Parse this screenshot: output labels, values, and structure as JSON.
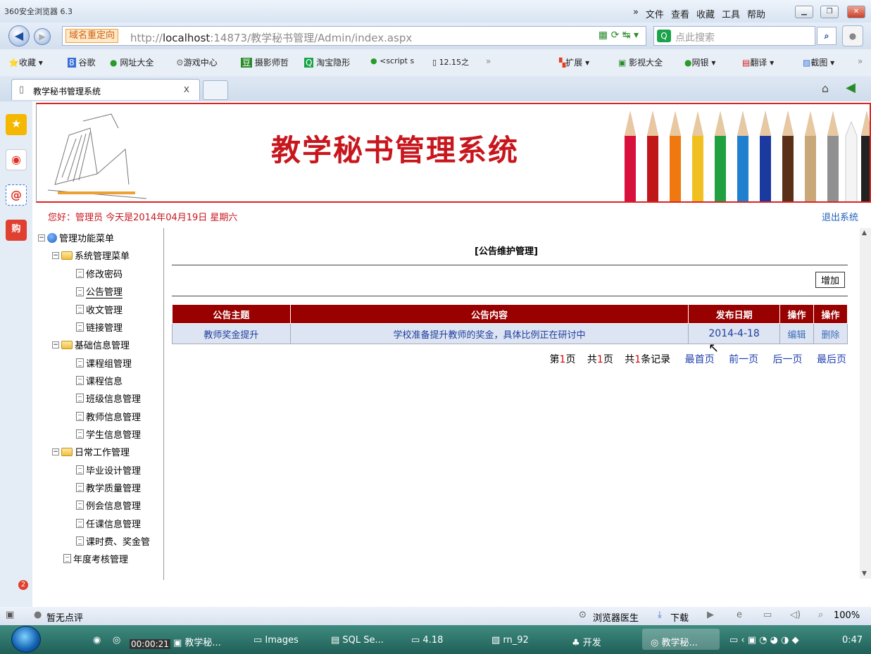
{
  "browser": {
    "app_title": "360安全浏览器 6.3",
    "menu": [
      "»",
      "文件",
      "查看",
      "收藏",
      "工具",
      "帮助"
    ],
    "redirect_badge": "域名重定向",
    "url_prefix": "http://",
    "url_host": "localhost",
    "url_rest": ":14873/教学秘书管理/Admin/index.aspx",
    "search_placeholder": "点此搜索",
    "favorites": [
      "收藏",
      "谷歌",
      "网址大全",
      "游戏中心",
      "摄影师哲",
      "淘宝隐形",
      "<script s",
      "12.15之",
      "»"
    ],
    "right_tools": [
      "扩展",
      "影视大全",
      "网银",
      "翻译",
      "截图",
      "»"
    ],
    "tab_label": "教学秘书管理系统",
    "tab_close": "x"
  },
  "site": {
    "banner_title": "教学秘书管理系统",
    "greeting": "您好：管理员   今天是2014年04月19日   星期六",
    "logout": "退出系统"
  },
  "tree": {
    "root": "管理功能菜单",
    "groups": [
      {
        "label": "系统管理菜单",
        "items": [
          "修改密码",
          "公告管理",
          "收文管理",
          "链接管理"
        ]
      },
      {
        "label": "基础信息管理",
        "items": [
          "课程组管理",
          "课程信息",
          "班级信息管理",
          "教师信息管理",
          "学生信息管理"
        ]
      },
      {
        "label": "日常工作管理",
        "items": [
          "毕业设计管理",
          "教学质量管理",
          "例会信息管理",
          "任课信息管理",
          "课时费、奖金管"
        ]
      }
    ],
    "last": "年度考核管理"
  },
  "main": {
    "page_title": "[公告维护管理]",
    "add_button": "增加",
    "columns": [
      "公告主题",
      "公告内容",
      "发布日期",
      "操作",
      "操作"
    ],
    "rows": [
      {
        "subject": "教师奖金提升",
        "content": "学校准备提升教师的奖金，具体比例正在研讨中",
        "date": "2014-4-18",
        "edit": "编辑",
        "delete": "删除"
      }
    ],
    "pager": {
      "page_prefix": "第",
      "page": "1",
      "page_suffix": "页",
      "total_prefix": "共",
      "total_pages": "1",
      "total_suffix": "页",
      "records_prefix": "共",
      "records": "1",
      "records_suffix": "条记录",
      "first": "最首页",
      "prev": "前一页",
      "next": "后一页",
      "last": "最后页"
    }
  },
  "status": {
    "left": "暂无点评",
    "doctor": "浏览器医生",
    "download": "下载",
    "zoom": "100%"
  },
  "taskbar": {
    "timer": "00:00:21",
    "items": [
      "教学秘...",
      "Images",
      "SQL Se...",
      "4.18",
      "rn_92",
      "开发",
      "教学秘..."
    ],
    "clock": "0:47"
  }
}
